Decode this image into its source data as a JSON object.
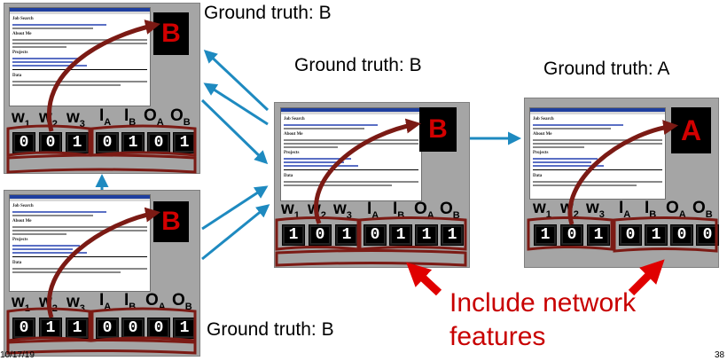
{
  "panels": [
    {
      "label": "B",
      "bits": [
        "0",
        "0",
        "1",
        "0",
        "1",
        "0",
        "1"
      ]
    },
    {
      "label": "B",
      "bits": [
        "0",
        "1",
        "1",
        "0",
        "0",
        "0",
        "1"
      ]
    },
    {
      "label": "B",
      "bits": [
        "1",
        "0",
        "1",
        "0",
        "1",
        "1",
        "1"
      ]
    },
    {
      "label": "A",
      "bits": [
        "1",
        "0",
        "1",
        "0",
        "1",
        "0",
        "0"
      ]
    }
  ],
  "headers": {
    "w": "w",
    "i": "I",
    "o": "O",
    "s1": "1",
    "s2": "2",
    "s3": "3",
    "sa": "A",
    "sb": "B"
  },
  "ground_truth": {
    "p1": "Ground truth: B",
    "p2": "Ground truth: B",
    "p3": "Ground truth: B",
    "p4": "Ground truth: A"
  },
  "callout": {
    "line1": "Include network",
    "line2": "features"
  },
  "footer": {
    "date": "10/17/19",
    "page": "38"
  },
  "shot_text": {
    "title": "Job Search",
    "sec1": "About Me",
    "sec2": "Projects",
    "sec3": "Data"
  },
  "colors": {
    "arrow_blue": "#1e8ac0",
    "curve_red": "#7b1a14",
    "label_red": "#d20000",
    "callout_red": "#c80000"
  }
}
